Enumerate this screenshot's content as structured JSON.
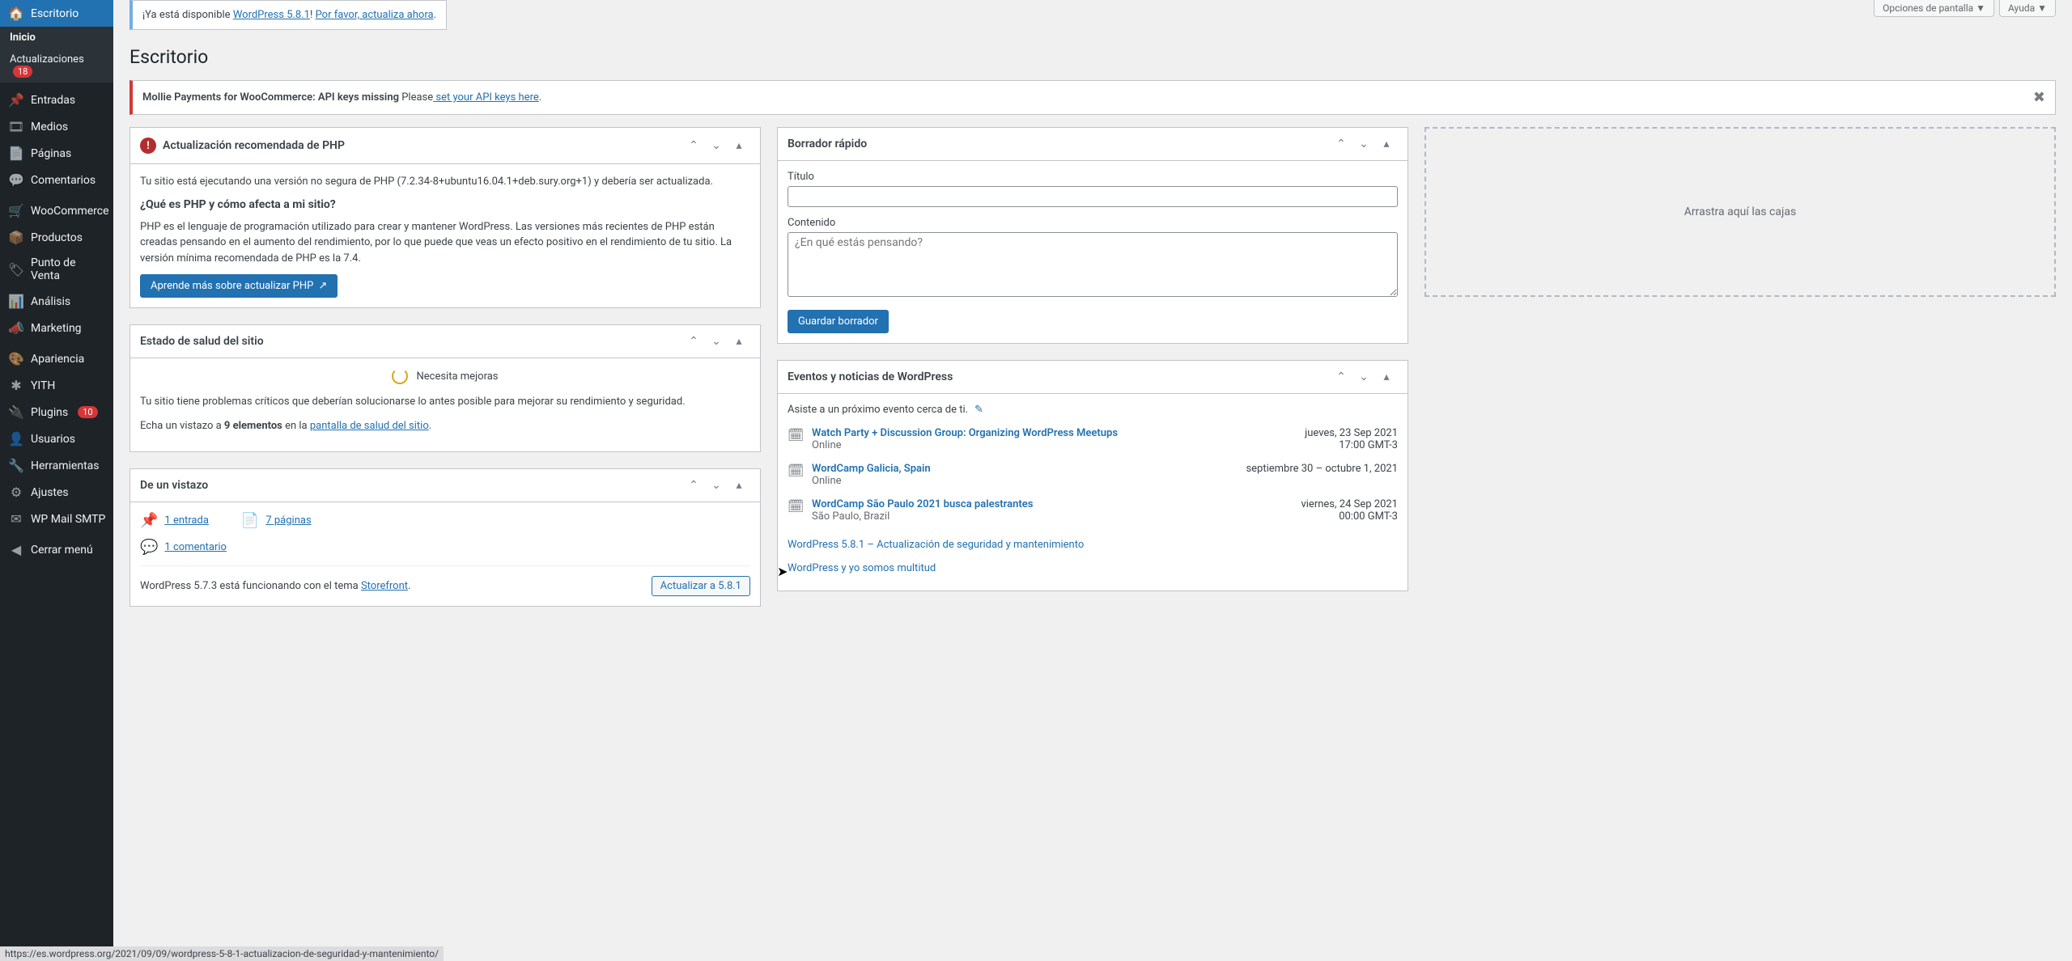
{
  "topActions": {
    "screenOptions": "Opciones de pantalla",
    "help": "Ayuda"
  },
  "sidebar": {
    "items": [
      {
        "label": "Escritorio",
        "icon": "🏠"
      },
      {
        "label": "Entradas",
        "icon": "📌"
      },
      {
        "label": "Medios",
        "icon": "🎞"
      },
      {
        "label": "Páginas",
        "icon": "📄"
      },
      {
        "label": "Comentarios",
        "icon": "💬"
      },
      {
        "label": "WooCommerce",
        "icon": "🛒"
      },
      {
        "label": "Productos",
        "icon": "📦"
      },
      {
        "label": "Punto de Venta",
        "icon": "🏷"
      },
      {
        "label": "Análisis",
        "icon": "📊"
      },
      {
        "label": "Marketing",
        "icon": "📣"
      },
      {
        "label": "Apariencia",
        "icon": "🎨"
      },
      {
        "label": "YITH",
        "icon": "✱"
      },
      {
        "label": "Plugins",
        "icon": "🔌"
      },
      {
        "label": "Usuarios",
        "icon": "👤"
      },
      {
        "label": "Herramientas",
        "icon": "🔧"
      },
      {
        "label": "Ajustes",
        "icon": "⚙"
      },
      {
        "label": "WP Mail SMTP",
        "icon": "✉"
      },
      {
        "label": "Cerrar menú",
        "icon": "◀"
      }
    ],
    "sub": {
      "inicio": "Inicio",
      "actualizaciones": "Actualizaciones",
      "updatesCount": "18",
      "pluginsCount": "10"
    }
  },
  "updateNotice": {
    "pre": "¡Ya está disponible ",
    "link1": "WordPress 5.8.1",
    "mid": "! ",
    "link2": "Por favor, actualiza ahora",
    "post": "."
  },
  "pageTitle": "Escritorio",
  "mollie": {
    "strong": "Mollie Payments for WooCommerce: API keys missing",
    "text": " Please",
    "link": " set your API keys here",
    "post": "."
  },
  "php": {
    "title": "Actualización recomendada de PHP",
    "p1": "Tu sitio está ejecutando una versión no segura de PHP (7.2.34-8+ubuntu16.04.1+deb.sury.org+1) y debería ser actualizada.",
    "h4": "¿Qué es PHP y cómo afecta a mi sitio?",
    "p2": "PHP es el lenguaje de programación utilizado para crear y mantener WordPress. Las versiones más recientes de PHP están creadas pensando en el aumento del rendimiento, por lo que puede que veas un efecto positivo en el rendimiento de tu sitio. La versión mínima recomendada de PHP es la 7.4.",
    "btn": "Aprende más sobre actualizar PHP"
  },
  "health": {
    "title": "Estado de salud del sitio",
    "status": "Necesita mejoras",
    "p1": "Tu sitio tiene problemas críticos que deberían solucionarse lo antes posible para mejorar su rendimiento y seguridad.",
    "pre": "Echa un vistazo a ",
    "bold": "9 elementos",
    "mid": " en la ",
    "link": "pantalla de salud del sitio",
    "post": "."
  },
  "glance": {
    "title": "De un vistazo",
    "entries": "1 entrada",
    "pages": "7 páginas",
    "comments": "1 comentario",
    "version": "WordPress 5.7.3 está funcionando con el tema ",
    "theme": "Storefront",
    "updateBtn": "Actualizar a 5.8.1"
  },
  "draft": {
    "title": "Borrador rápido",
    "titleLabel": "Título",
    "contentLabel": "Contenido",
    "placeholder": "¿En qué estás pensando?",
    "saveBtn": "Guardar borrador"
  },
  "events": {
    "title": "Eventos y noticias de WordPress",
    "intro": "Asiste a un próximo evento cerca de ti.",
    "list": [
      {
        "title": "Watch Party + Discussion Group: Organizing WordPress Meetups",
        "loc": "Online",
        "date": "jueves, 23 Sep 2021",
        "time": "17:00 GMT-3"
      },
      {
        "title": "WordCamp Galicia, Spain",
        "loc": "Online",
        "date": "septiembre 30 – octubre 1, 2021",
        "time": ""
      },
      {
        "title": "WordCamp São Paulo 2021 busca palestrantes",
        "loc": "São Paulo, Brazil",
        "date": "viernes, 24 Sep 2021",
        "time": "00:00 GMT-3"
      }
    ],
    "news": [
      "WordPress 5.8.1 – Actualización de seguridad y mantenimiento",
      "WordPress y yo somos multitud"
    ]
  },
  "dropzone": "Arrastra aquí las cajas",
  "statusbar": "https://es.wordpress.org/2021/09/09/wordpress-5-8-1-actualizacion-de-seguridad-y-mantenimiento/"
}
